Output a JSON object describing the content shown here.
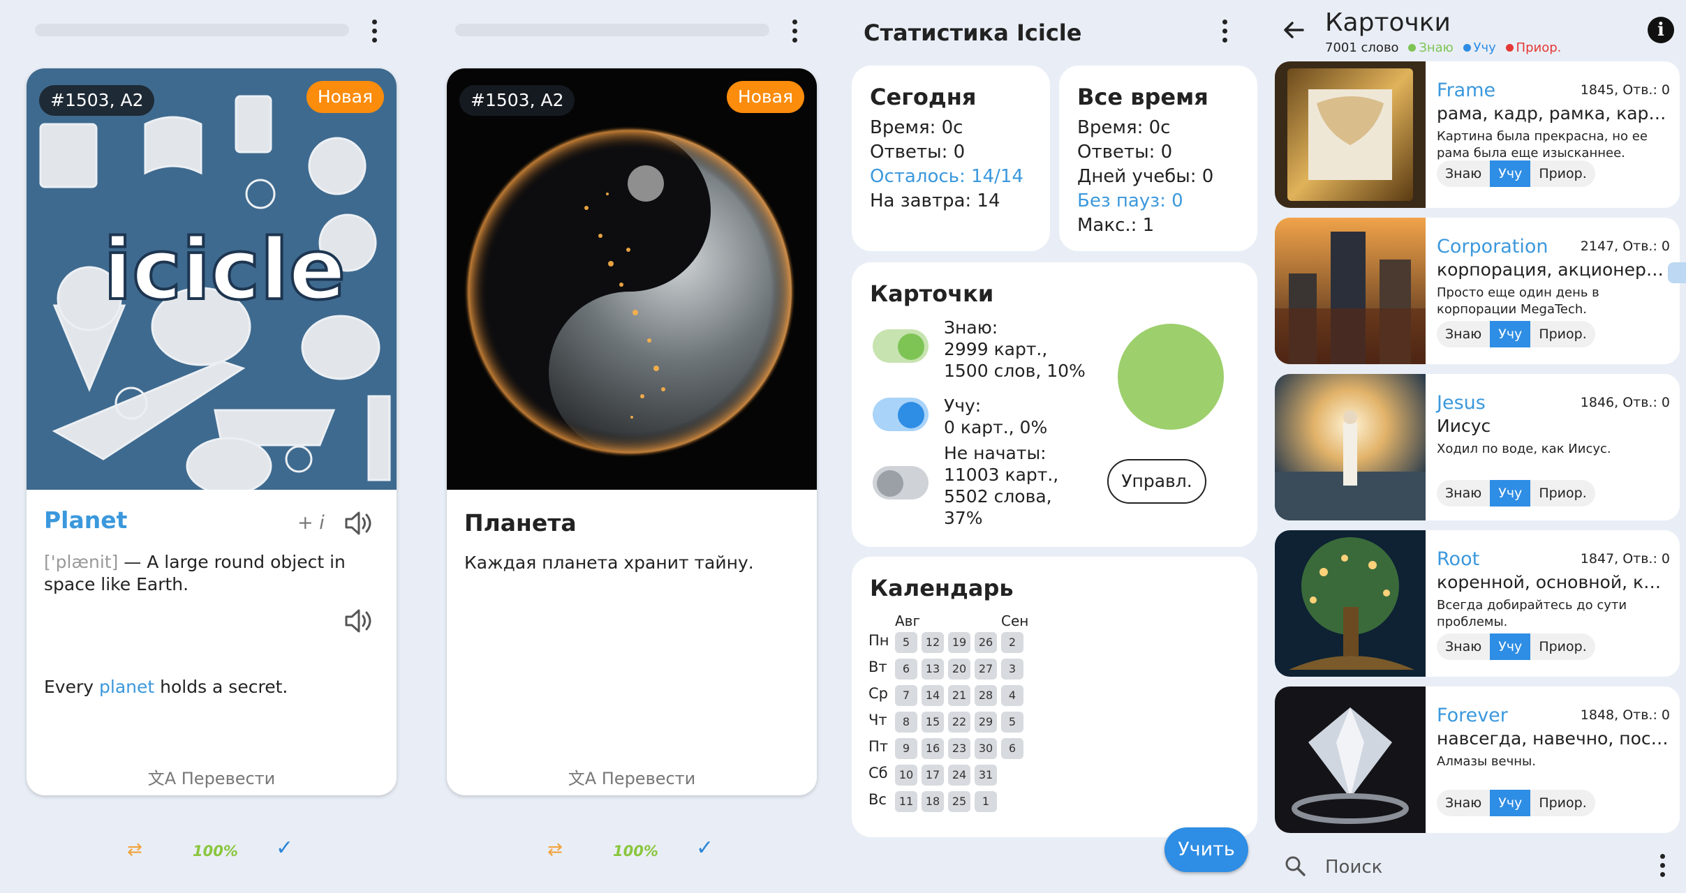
{
  "p1": {
    "id_badge": "#1503, A2",
    "new_badge": "Новая",
    "word": "Planet",
    "plus_i": "+ i",
    "ipa": "['plænit]",
    "definition": " — A large round object in space like Earth.",
    "example_before": "Every ",
    "example_highlight": "planet",
    "example_after": " holds a secret.",
    "translate": "文A Перевести",
    "bottom": {
      "swap": "⇄",
      "percent": "100%",
      "check": "✓"
    }
  },
  "p2": {
    "id_badge": "#1503, A2",
    "new_badge": "Новая",
    "word": "Планета",
    "sentence": "Каждая планета хранит тайну.",
    "translate": "文A Перевести",
    "bottom": {
      "swap": "⇄",
      "percent": "100%",
      "check": "✓"
    }
  },
  "p3": {
    "title": "Статистика Icicle",
    "today": {
      "title": "Сегодня",
      "time": "Время: 0с",
      "answers": "Ответы: 0",
      "left": "Осталось: 14/14",
      "tomorrow": "На завтра: 14"
    },
    "alltime": {
      "title": "Все время",
      "time": "Время: 0с",
      "answers": "Ответы: 0",
      "days": "Дней учебы: 0",
      "nopause": "Без пауз: 0",
      "max": "Макс.: 1"
    },
    "cards": {
      "title": "Карточки",
      "know_label": "Знаю:",
      "know_value": "2999 карт.,",
      "know_value2": "1500 слов, 10%",
      "learn_label": "Учу:",
      "learn_value": "0 карт., 0%",
      "notstarted_label": "Не начаты:",
      "notstarted_value": "11003 карт.,",
      "notstarted_value2": "5502 слова,",
      "notstarted_value3": "37%",
      "manage": "Управл."
    },
    "calendar": {
      "title": "Календарь",
      "months": [
        "Авг",
        "Сен"
      ],
      "days": [
        "Пн",
        "Вт",
        "Ср",
        "Чт",
        "Пт",
        "Сб",
        "Вс"
      ],
      "columns": [
        [
          "5",
          "6",
          "7",
          "8",
          "9",
          "10",
          "11"
        ],
        [
          "12",
          "13",
          "14",
          "15",
          "16",
          "17",
          "18"
        ],
        [
          "19",
          "20",
          "21",
          "22",
          "23",
          "24",
          "25"
        ],
        [
          "26",
          "27",
          "28",
          "29",
          "30",
          "31",
          "1"
        ],
        [
          "2",
          "3",
          "4",
          "5",
          "6",
          "",
          ""
        ]
      ]
    },
    "learn_button": "Учить"
  },
  "p4": {
    "title": "Карточки",
    "count": "7001 слово",
    "legend": {
      "know": "Знаю",
      "learn": "Учу",
      "prior": "Приор."
    },
    "colors": {
      "know": "#7ec455",
      "learn": "#2e8de4",
      "prior": "#e53935"
    },
    "chips": {
      "know": "Знаю",
      "learn": "Учу",
      "prior": "Приор."
    },
    "items": [
      {
        "word": "Frame",
        "meta": "1845, Отв.: 0",
        "translation": "рама, кадр, рамка, каркас",
        "example": "Картина была прекрасна, но ее рама была еще изысканнее."
      },
      {
        "word": "Corporation",
        "meta": "2147, Отв.: 0",
        "translation": "корпорация, акционерное общество",
        "example": "Просто еще один день в корпорации MegaTech."
      },
      {
        "word": "Jesus",
        "meta": "1846, Отв.: 0",
        "translation": "Иисус",
        "example": "Ходил по воде, как Иисус."
      },
      {
        "word": "Root",
        "meta": "1847, Отв.: 0",
        "translation": "коренной, основной, корень",
        "example": "Всегда добирайтесь до сути проблемы."
      },
      {
        "word": "Forever",
        "meta": "1848, Отв.: 0",
        "translation": "навсегда, навечно, постоянно",
        "example": "Алмазы вечны."
      }
    ],
    "search_placeholder": "Поиск"
  }
}
